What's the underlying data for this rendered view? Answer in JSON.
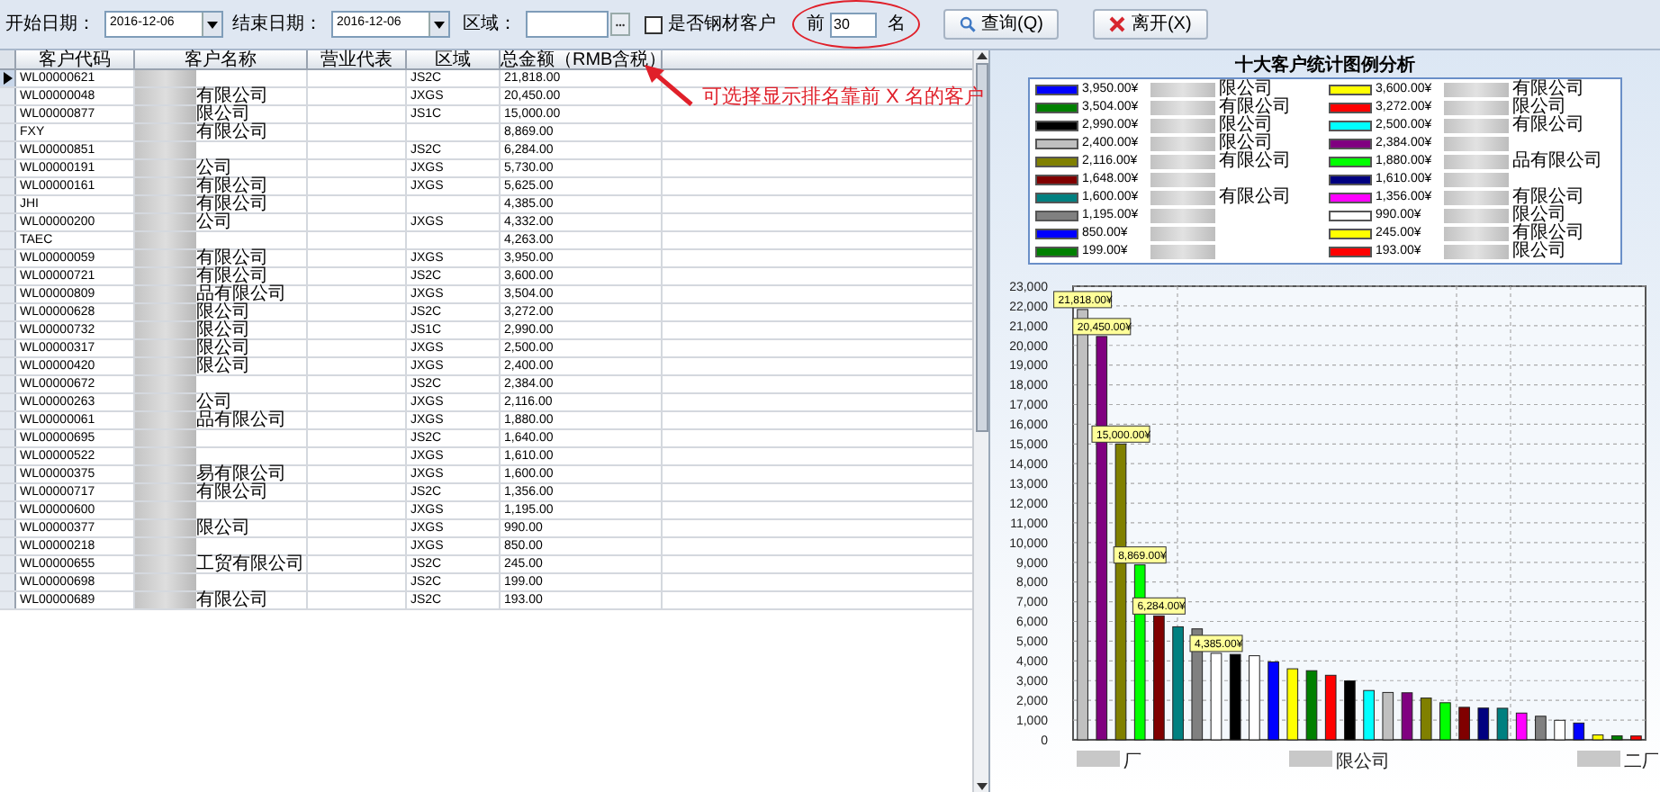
{
  "toolbar": {
    "start_date": {
      "label": "开始日期：",
      "value": "2016-12-06"
    },
    "end_date": {
      "label": "结束日期：",
      "value": "2016-12-06"
    },
    "region": {
      "label": "区域："
    },
    "steel_customer": {
      "label": "是否钢材客户",
      "checked": false
    },
    "top_n": {
      "prefix": "前",
      "value": "30",
      "suffix": "名"
    },
    "buttons": [
      {
        "label": "查询(Q)",
        "kind": "search"
      },
      {
        "label": "离开(X)",
        "kind": "exit"
      }
    ]
  },
  "annotation": {
    "text": "可选择显示排名靠前 X 名的客户"
  },
  "table": {
    "columns": [
      "客户代码",
      "客户名称",
      "营业代表",
      "区域",
      "总金额（RMB含税）"
    ],
    "rows": [
      {
        "code": "WL00000621",
        "region": "JS2C",
        "total": "21,818.00",
        "selected": true
      },
      {
        "code": "WL00000048",
        "name": "有限公司",
        "region": "JXGS",
        "total": "20,450.00",
        "selected": false
      },
      {
        "code": "WL00000877",
        "name": "限公司",
        "region": "JS1C",
        "total": "15,000.00",
        "selected": false
      },
      {
        "code": "FXY",
        "name": "有限公司",
        "total": "8,869.00",
        "selected": false
      },
      {
        "code": "WL00000851",
        "region": "JS2C",
        "total": "6,284.00",
        "selected": false
      },
      {
        "code": "WL00000191",
        "name": "公司",
        "region": "JXGS",
        "total": "5,730.00",
        "selected": false
      },
      {
        "code": "WL00000161",
        "name": "有限公司",
        "region": "JXGS",
        "total": "5,625.00",
        "selected": false
      },
      {
        "code": "JHI",
        "name": "有限公司",
        "total": "4,385.00",
        "selected": false
      },
      {
        "code": "WL00000200",
        "name": "公司",
        "region": "JXGS",
        "total": "4,332.00",
        "selected": false
      },
      {
        "code": "TAEC",
        "total": "4,263.00",
        "selected": false
      },
      {
        "code": "WL00000059",
        "name": "有限公司",
        "region": "JXGS",
        "total": "3,950.00",
        "selected": false
      },
      {
        "code": "WL00000721",
        "name": "有限公司",
        "region": "JS2C",
        "total": "3,600.00",
        "selected": false
      },
      {
        "code": "WL00000809",
        "name": "品有限公司",
        "region": "JXGS",
        "total": "3,504.00",
        "selected": false
      },
      {
        "code": "WL00000628",
        "name": "限公司",
        "region": "JS2C",
        "total": "3,272.00",
        "selected": false
      },
      {
        "code": "WL00000732",
        "name": "限公司",
        "region": "JS1C",
        "total": "2,990.00",
        "selected": false
      },
      {
        "code": "WL00000317",
        "name": "限公司",
        "region": "JXGS",
        "total": "2,500.00",
        "selected": false
      },
      {
        "code": "WL00000420",
        "name": "限公司",
        "region": "JXGS",
        "total": "2,400.00",
        "selected": false
      },
      {
        "code": "WL00000672",
        "region": "JS2C",
        "total": "2,384.00",
        "selected": false
      },
      {
        "code": "WL00000263",
        "name": "公司",
        "region": "JXGS",
        "total": "2,116.00",
        "selected": false
      },
      {
        "code": "WL00000061",
        "name": "品有限公司",
        "region": "JXGS",
        "total": "1,880.00",
        "selected": false
      },
      {
        "code": "WL00000695",
        "region": "JS2C",
        "total": "1,640.00",
        "selected": false
      },
      {
        "code": "WL00000522",
        "region": "JXGS",
        "total": "1,610.00",
        "selected": false
      },
      {
        "code": "WL00000375",
        "name": "易有限公司",
        "region": "JXGS",
        "total": "1,600.00",
        "selected": false
      },
      {
        "code": "WL00000717",
        "name": "有限公司",
        "region": "JS2C",
        "total": "1,356.00",
        "selected": false
      },
      {
        "code": "WL00000600",
        "region": "JXGS",
        "total": "1,195.00",
        "selected": false
      },
      {
        "code": "WL00000377",
        "name": "限公司",
        "region": "JXGS",
        "total": "990.00",
        "selected": false
      },
      {
        "code": "WL00000218",
        "region": "JXGS",
        "total": "850.00",
        "selected": false
      },
      {
        "code": "WL00000655",
        "name": "工贸有限公司",
        "region": "JS2C",
        "total": "245.00",
        "selected": false
      },
      {
        "code": "WL00000698",
        "region": "JS2C",
        "total": "199.00",
        "selected": false
      },
      {
        "code": "WL00000689",
        "name": "有限公司",
        "region": "JS2C",
        "total": "193.00",
        "selected": false
      }
    ]
  },
  "chart": {
    "legend": [
      {
        "value": "3,950.00¥",
        "name": "限公司",
        "color": "#0000ff"
      },
      {
        "value": "3,504.00¥",
        "name": "有限公司",
        "color": "#008000"
      },
      {
        "value": "2,990.00¥",
        "name": "限公司",
        "color": "#000000"
      },
      {
        "value": "2,400.00¥",
        "name": "限公司",
        "color": "#c0c0c0"
      },
      {
        "value": "2,116.00¥",
        "name": "有限公司",
        "color": "#808000"
      },
      {
        "value": "1,648.00¥",
        "color": "#800000"
      },
      {
        "value": "1,600.00¥",
        "name": "有限公司",
        "color": "#008080"
      },
      {
        "value": "1,195.00¥",
        "color": "#808080"
      },
      {
        "value": "850.00¥",
        "color": "#0000ff"
      },
      {
        "value": "199.00¥",
        "color": "#008000"
      },
      {
        "value": "3,600.00¥",
        "name": "有限公司",
        "color": "#ffff00"
      },
      {
        "value": "3,272.00¥",
        "name": "限公司",
        "color": "#ff0000"
      },
      {
        "value": "2,500.00¥",
        "name": "有限公司",
        "color": "#00ffff"
      },
      {
        "value": "2,384.00¥",
        "color": "#800080"
      },
      {
        "value": "1,880.00¥",
        "name": "品有限公司",
        "color": "#00ff00"
      },
      {
        "value": "1,610.00¥",
        "color": "#000080"
      },
      {
        "value": "1,356.00¥",
        "name": "有限公司",
        "color": "#ff00ff"
      },
      {
        "value": "990.00¥",
        "name": "限公司",
        "color": "#ffffff"
      },
      {
        "value": "245.00¥",
        "name": "有限公司",
        "color": "#ffff00"
      },
      {
        "value": "193.00¥",
        "name": "限公司",
        "color": "#ff0000"
      }
    ],
    "axis_labels": [
      "厂",
      "限公司",
      "二厂"
    ],
    "chart_data": {
      "type": "bar",
      "title": "十大客户统计图例分析",
      "values": [
        21818,
        20450,
        15000,
        8869,
        6284,
        5730,
        5625,
        4385,
        4332,
        4263,
        3950,
        3600,
        3504,
        3272,
        2990,
        2500,
        2400,
        2384,
        2116,
        1880,
        1648,
        1610,
        1600,
        1356,
        1195,
        990,
        850,
        245,
        199,
        193
      ],
      "colors": [
        "#c0c0c0",
        "#800080",
        "#808000",
        "#00ff00",
        "#800000",
        "#008080",
        "#808080",
        "#ffffff",
        "#000000",
        "#ffffff",
        "#0000ff",
        "#ffff00",
        "#008000",
        "#ff0000",
        "#000000",
        "#00ffff",
        "#c0c0c0",
        "#800080",
        "#808000",
        "#00ff00",
        "#800000",
        "#000080",
        "#008080",
        "#ff00ff",
        "#808080",
        "#ffffff",
        "#0000ff",
        "#ffff00",
        "#008000",
        "#ff0000"
      ],
      "value_labels": [
        "21,818.00¥",
        "20,450.00¥",
        "15,000.00¥",
        "8,869.00¥",
        "6,284.00¥",
        null,
        null,
        "4,385.00¥",
        null,
        null,
        null,
        null,
        null,
        null,
        null,
        null,
        null,
        null,
        null,
        null,
        null,
        null,
        null,
        null,
        null,
        null,
        null,
        null,
        null,
        null
      ],
      "ylim": [
        0,
        23000
      ],
      "yticks": [
        0,
        {
          "value": 1000,
          "label": "1,000"
        },
        {
          "value": 2000,
          "label": "2,000"
        },
        {
          "value": 3000,
          "label": "3,000"
        },
        {
          "value": 4000,
          "label": "4,000"
        },
        {
          "value": 5000,
          "label": "5,000"
        },
        {
          "value": 6000,
          "label": "6,000"
        },
        {
          "value": 7000,
          "label": "7,000"
        },
        {
          "value": 8000,
          "label": "8,000"
        },
        {
          "value": 9000,
          "label": "9,000"
        },
        {
          "value": 10000,
          "label": "10,000"
        },
        {
          "value": 11000,
          "label": "11,000"
        },
        {
          "value": 12000,
          "label": "12,000"
        },
        {
          "value": 13000,
          "label": "13,000"
        },
        {
          "value": 14000,
          "label": "14,000"
        },
        {
          "value": 15000,
          "label": "15,000"
        },
        {
          "value": 16000,
          "label": "16,000"
        },
        {
          "value": 17000,
          "label": "17,000"
        },
        {
          "value": 18000,
          "label": "18,000"
        },
        {
          "value": 19000,
          "label": "19,000"
        },
        {
          "value": 20000,
          "label": "20,000"
        },
        {
          "value": 21000,
          "label": "21,000"
        },
        {
          "value": 22000,
          "label": "22,000"
        },
        {
          "value": 23000,
          "label": "23,000"
        }
      ],
      "grid": true
    }
  }
}
